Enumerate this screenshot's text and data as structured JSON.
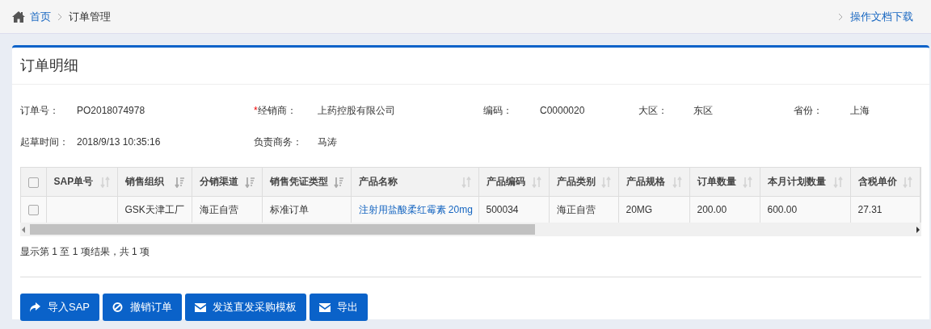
{
  "breadcrumb": [
    {
      "label": "首页"
    },
    {
      "label": "订单管理"
    }
  ],
  "doc_link": "操作文档下载",
  "card": {
    "title": "订单明细"
  },
  "fields": [
    {
      "label": "订单号：",
      "value": "PO2018074978"
    },
    {
      "label": "经销商：",
      "value": "上药控股有限公司",
      "required_mark": "*"
    },
    {
      "label": "编码：",
      "value": "C0000020"
    },
    {
      "label": "大区：",
      "value": "东区"
    },
    {
      "label": "省份：",
      "value": "上海"
    },
    {
      "label": "起草时间：",
      "value": "2018/9/13 10:35:16"
    },
    {
      "label": "负责商务：",
      "value": "马涛"
    }
  ],
  "table": {
    "select_all_checked": false,
    "columns": [
      {
        "label": "SAP单号",
        "sorted": false
      },
      {
        "label": "销售组织",
        "sorted": true
      },
      {
        "label": "分销渠道",
        "sorted": true
      },
      {
        "label": "销售凭证类型",
        "sorted": true
      },
      {
        "label": "产品名称",
        "sorted": false
      },
      {
        "label": "产品编码",
        "sorted": false
      },
      {
        "label": "产品类别",
        "sorted": false
      },
      {
        "label": "产品规格",
        "sorted": false
      },
      {
        "label": "订单数量",
        "sorted": false
      },
      {
        "label": "本月计划数量",
        "sorted": false
      },
      {
        "label": "含税单价",
        "sorted": false
      }
    ],
    "rows": [
      {
        "checked": false,
        "cells": [
          "",
          "GSK天津工厂",
          "海正自营",
          "标准订单",
          "注射用盐酸柔红霉素 20mg",
          "500034",
          "海正自营",
          "20MG",
          "200.00",
          "600.00",
          "27.31"
        ]
      }
    ]
  },
  "info": "显示第 1 至 1 项结果，共 1 项",
  "buttons": [
    {
      "label": "导入SAP",
      "kind": "share"
    },
    {
      "label": "撤销订单",
      "kind": "ban"
    },
    {
      "label": "发送直发采购模板",
      "kind": "mail"
    },
    {
      "label": "导出",
      "kind": "mail"
    }
  ]
}
